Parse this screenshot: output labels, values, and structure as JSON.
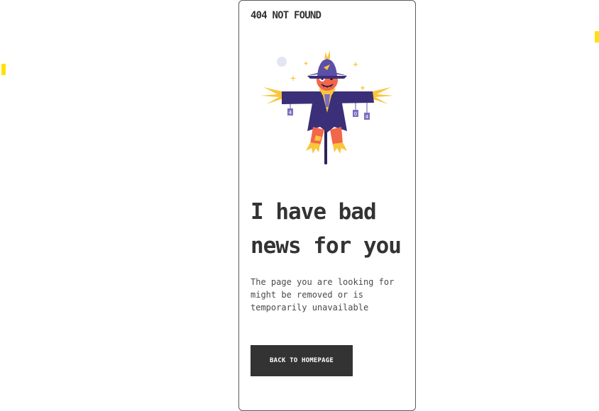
{
  "brand": {
    "label": "404 NOT FOUND"
  },
  "illustration": {
    "name": "scarecrow-illustration",
    "tags": [
      "4",
      "0",
      "4"
    ]
  },
  "headline": {
    "line1": "I have bad",
    "line2": "news for you"
  },
  "message": "The page you are looking for might be removed or is temporarily unavailable",
  "button": {
    "label": "BACK TO HOMEPAGE"
  },
  "colors": {
    "accent": "#ffe10a",
    "text": "#333333",
    "button_bg": "#333333",
    "button_text": "#ffffff",
    "coat": "#3a2f78",
    "face": "#f2664a",
    "straw": "#f9c63b"
  }
}
